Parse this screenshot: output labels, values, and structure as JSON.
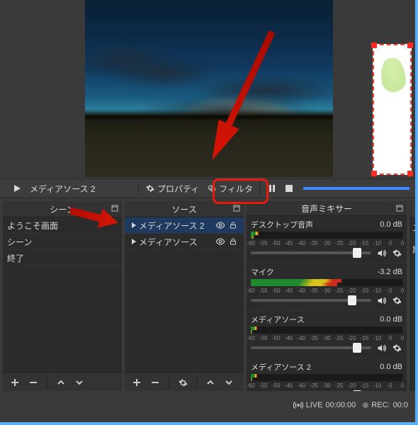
{
  "mediaBar": {
    "source_label": "メディアソース 2",
    "properties_label": "プロパティ",
    "filter_label": "フィルタ"
  },
  "panels": {
    "scenes": {
      "title": "シーン",
      "items": [
        {
          "label": "ようこそ画面",
          "selected": false
        },
        {
          "label": "シーン",
          "selected": false
        },
        {
          "label": "終了",
          "selected": false
        }
      ]
    },
    "sources": {
      "title": "ソース",
      "items": [
        {
          "label": "メディアソース 2",
          "selected": true,
          "visible": true,
          "locked": true
        },
        {
          "label": "メディアソース",
          "selected": false,
          "visible": true,
          "locked": true
        }
      ]
    },
    "mixer": {
      "title": "音声ミキサー",
      "ticks": [
        "-60",
        "-55",
        "-50",
        "-45",
        "-40",
        "-35",
        "-30",
        "-25",
        "-20",
        "-15",
        "-10",
        "-5",
        "0"
      ],
      "channels": [
        {
          "name": "デスクトップ音声",
          "db": "0.0 dB",
          "level_pct": 5,
          "fader_pct": 88
        },
        {
          "name": "マイク",
          "db": "-3.2 dB",
          "level_pct": 60,
          "fader_pct": 84
        },
        {
          "name": "メディアソース",
          "db": "0.0 dB",
          "level_pct": 4,
          "fader_pct": 88
        },
        {
          "name": "メディアソース 2",
          "db": "0.0 dB",
          "level_pct": 4,
          "fader_pct": 88
        }
      ]
    },
    "extra": {
      "lines": [
        "スイ",
        "期間"
      ]
    }
  },
  "status": {
    "live_label": "LIVE",
    "live_time": "00:00:00",
    "rec_label": "REC:",
    "rec_time": "00:0"
  }
}
